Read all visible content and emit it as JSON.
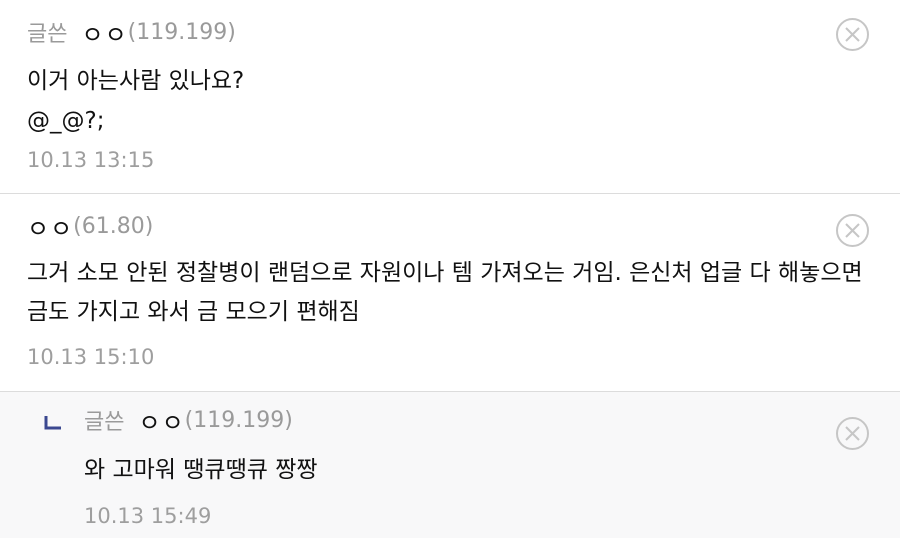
{
  "comments": [
    {
      "writer_badge": "글쓴",
      "nickname": "ㅇㅇ",
      "ip": "(119.199)",
      "lines": [
        "이거 아는사람 있나요?",
        "@_@?;"
      ],
      "timestamp": "10.13 13:15",
      "delete_icon": "close-circle-icon"
    },
    {
      "nickname": "ㅇㅇ",
      "ip": "(61.80)",
      "text": "그거 소모 안된 정찰병이 랜덤으로 자원이나 템 가져오는 거임. 은신처 업글 다 해놓으면 금도 가지고 와서 금 모으기 편해짐",
      "timestamp": "10.13 15:10",
      "delete_icon": "close-circle-icon"
    },
    {
      "is_reply": true,
      "reply_icon": "reply-arrow-icon",
      "writer_badge": "글쓴",
      "nickname": "ㅇㅇ",
      "ip": "(119.199)",
      "text": "와 고마워 땡큐땡큐 짱짱",
      "timestamp": "10.13 15:49",
      "delete_icon": "close-circle-icon"
    }
  ],
  "colors": {
    "meta_gray": "#9a9a9a",
    "text": "#111111",
    "reply_bg": "#f8f8f9",
    "reply_arrow": "#3b4890",
    "divider": "#dcdcdc"
  }
}
